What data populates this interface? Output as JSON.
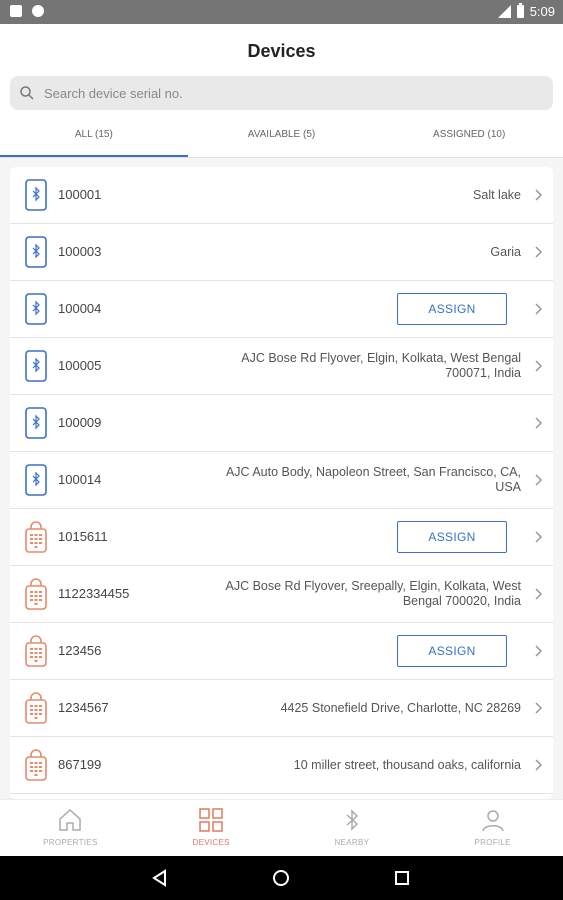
{
  "status_bar": {
    "time": "5:09"
  },
  "header": {
    "title": "Devices"
  },
  "search": {
    "placeholder": "Search device serial no."
  },
  "tabs": [
    {
      "label": "ALL (15)",
      "active": true
    },
    {
      "label": "AVAILABLE (5)",
      "active": false
    },
    {
      "label": "ASSIGNED (10)",
      "active": false
    }
  ],
  "assign_label": "ASSIGN",
  "devices": [
    {
      "serial": "100001",
      "icon": "bluetooth-device-icon",
      "location": "Salt lake"
    },
    {
      "serial": "100003",
      "icon": "bluetooth-device-icon",
      "location": "Garia"
    },
    {
      "serial": "100004",
      "icon": "bluetooth-device-icon",
      "location": null
    },
    {
      "serial": "100005",
      "icon": "bluetooth-device-icon",
      "location": "AJC Bose Rd Flyover, Elgin, Kolkata, West Bengal 700071, India"
    },
    {
      "serial": "100009",
      "icon": "bluetooth-device-icon",
      "location": ""
    },
    {
      "serial": "100014",
      "icon": "bluetooth-device-icon",
      "location": "AJC Auto Body, Napoleon Street, San Francisco, CA, USA"
    },
    {
      "serial": "1015611",
      "icon": "keypad-lock-icon",
      "location": null
    },
    {
      "serial": "1122334455",
      "icon": "keypad-lock-icon",
      "location": "AJC Bose Rd Flyover, Sreepally, Elgin, Kolkata, West Bengal 700020, India"
    },
    {
      "serial": "123456",
      "icon": "keypad-lock-icon",
      "location": null
    },
    {
      "serial": "1234567",
      "icon": "keypad-lock-icon",
      "location": "4425 Stonefield Drive, Charlotte, NC 28269"
    },
    {
      "serial": "867199",
      "icon": "keypad-lock-icon",
      "location": "10 miller street, thousand oaks, california"
    }
  ],
  "bottom_nav": [
    {
      "label": "PROPERTIES",
      "icon": "home-icon",
      "active": false
    },
    {
      "label": "DEVICES",
      "icon": "grid-icon",
      "active": true
    },
    {
      "label": "NEARBY",
      "icon": "bluetooth-icon",
      "active": false
    },
    {
      "label": "PROFILE",
      "icon": "person-icon",
      "active": false
    }
  ],
  "colors": {
    "accent": "#3b6fc8",
    "active_nav": "#e07a5f",
    "lock_icon": "#e8896b"
  }
}
